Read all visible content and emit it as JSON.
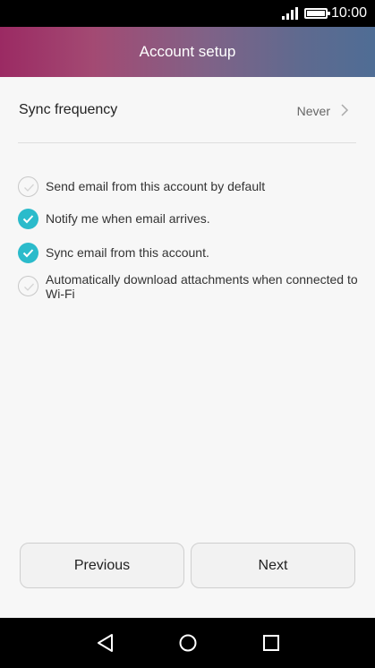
{
  "status_bar": {
    "time": "10:00",
    "icons": [
      "signal-icon",
      "battery-icon"
    ]
  },
  "header": {
    "title": "Account setup"
  },
  "sync": {
    "label": "Sync frequency",
    "value": "Never",
    "icon": "chevron-right-icon"
  },
  "options": [
    {
      "label": "Send email from this account by default",
      "checked": false
    },
    {
      "label": "Notify me when email arrives.",
      "checked": true
    },
    {
      "label": "Sync email from this account.",
      "checked": true
    },
    {
      "label": "Automatically download attachments when connected to Wi-Fi",
      "checked": false
    }
  ],
  "buttons": {
    "previous": "Previous",
    "next": "Next"
  },
  "nav": {
    "icons": [
      "back-icon",
      "home-icon",
      "recent-apps-icon"
    ]
  },
  "colors": {
    "accent": "#2bbbcb",
    "header_start": "#9b2a63",
    "header_end": "#4f6d95"
  }
}
